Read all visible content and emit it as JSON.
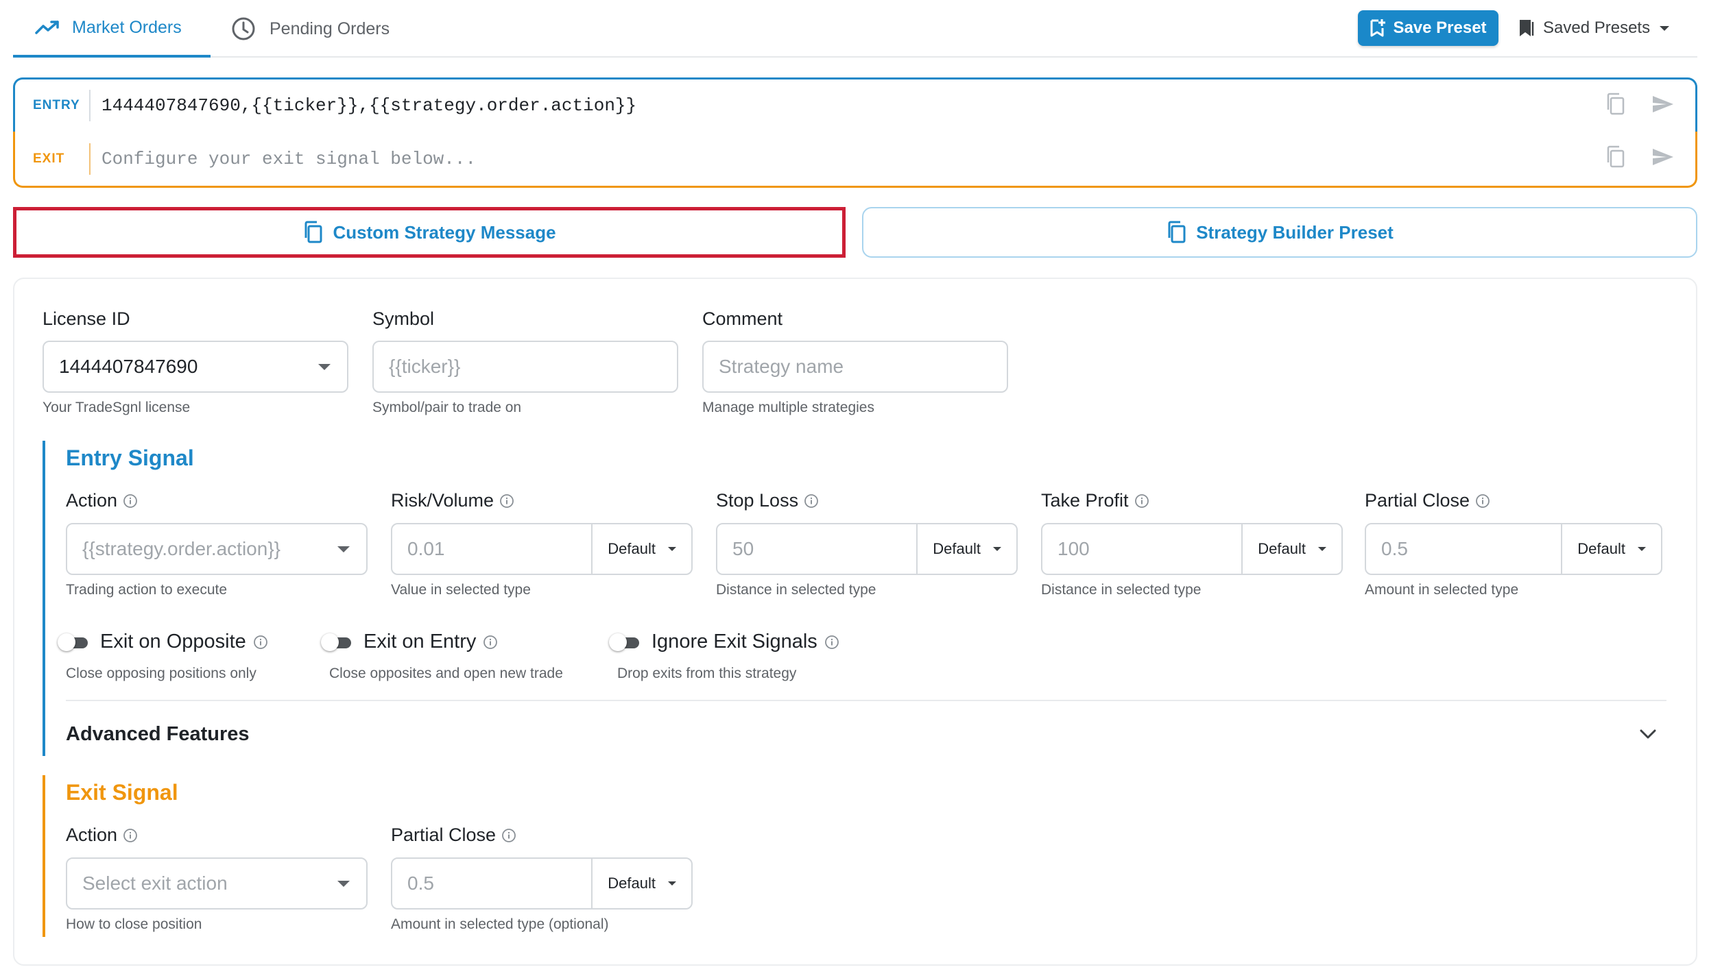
{
  "tabs": {
    "market": "Market Orders",
    "pending": "Pending Orders"
  },
  "toolbar": {
    "save_preset": "Save Preset",
    "saved_presets": "Saved Presets"
  },
  "signals": {
    "entry_tag": "ENTRY",
    "entry_text": "1444407847690,{{ticker}},{{strategy.order.action}}",
    "exit_tag": "EXIT",
    "exit_placeholder": "Configure your exit signal below..."
  },
  "modes": {
    "custom": "Custom Strategy Message",
    "builder": "Strategy Builder Preset"
  },
  "general": {
    "license_label": "License ID",
    "license_value": "1444407847690",
    "license_help": "Your TradeSgnl license",
    "symbol_label": "Symbol",
    "symbol_placeholder": "{{ticker}}",
    "symbol_help": "Symbol/pair to trade on",
    "comment_label": "Comment",
    "comment_placeholder": "Strategy name",
    "comment_help": "Manage multiple strategies"
  },
  "entry": {
    "title": "Entry Signal",
    "action_label": "Action",
    "action_placeholder": "{{strategy.order.action}}",
    "action_help": "Trading action to execute",
    "risk_label": "Risk/Volume",
    "risk_placeholder": "0.01",
    "risk_unit": "Default",
    "risk_help": "Value in selected type",
    "sl_label": "Stop Loss",
    "sl_placeholder": "50",
    "sl_unit": "Default",
    "sl_help": "Distance in selected type",
    "tp_label": "Take Profit",
    "tp_placeholder": "100",
    "tp_unit": "Default",
    "tp_help": "Distance in selected type",
    "pc_label": "Partial Close",
    "pc_placeholder": "0.5",
    "pc_unit": "Default",
    "pc_help": "Amount in selected type",
    "toggles": [
      {
        "label": "Exit on Opposite",
        "help": "Close opposing positions only",
        "on": false
      },
      {
        "label": "Exit on Entry",
        "help": "Close opposites and open new trade",
        "on": false
      },
      {
        "label": "Ignore Exit Signals",
        "help": "Drop exits from this strategy",
        "on": false
      }
    ],
    "advanced": "Advanced Features"
  },
  "exit": {
    "title": "Exit Signal",
    "action_label": "Action",
    "action_placeholder": "Select exit action",
    "action_help": "How to close position",
    "pc_label": "Partial Close",
    "pc_placeholder": "0.5",
    "pc_unit": "Default",
    "pc_help": "Amount in selected type (optional)"
  },
  "colors": {
    "primary": "#1e88c8",
    "exit_accent": "#f0960e",
    "highlight": "#cc1f36"
  }
}
